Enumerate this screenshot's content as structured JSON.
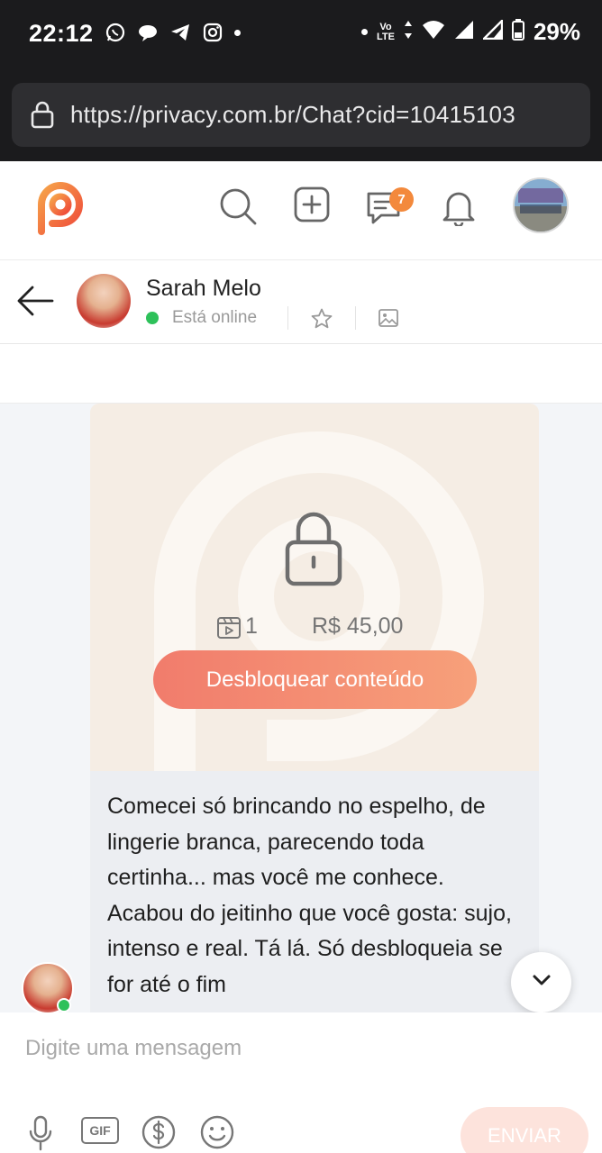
{
  "status_bar": {
    "time": "22:12",
    "network": "LTE",
    "volte": "Vo",
    "battery": "29%"
  },
  "browser": {
    "url": "https://privacy.com.br/Chat?cid=10415103"
  },
  "app_header": {
    "messages_badge": "7",
    "icons": [
      "search-icon",
      "add-post-icon",
      "messages-icon",
      "bell-icon"
    ]
  },
  "chat_header": {
    "contact_name": "Sarah Melo",
    "status": "Está online"
  },
  "locked_content": {
    "media_count": "1",
    "price": "R$ 45,00",
    "unlock_label": "Desbloquear conteúdo"
  },
  "message": {
    "text": "Comecei só brincando no espelho, de lingerie branca, parecendo toda certinha... mas você me conhece. Acabou do jeitinho que você gosta: sujo, intenso e real. Tá lá. Só desbloqueia se for até o fim"
  },
  "composer": {
    "placeholder": "Digite uma mensagem",
    "gif_label": "GIF",
    "send_label": "ENVIAR"
  },
  "colors": {
    "brand_orange": "#f3893c",
    "unlock_gradient_start": "#f17c6c",
    "unlock_gradient_end": "#f7a07a",
    "online_green": "#2ec15a",
    "card_bg": "#f5ede4"
  }
}
